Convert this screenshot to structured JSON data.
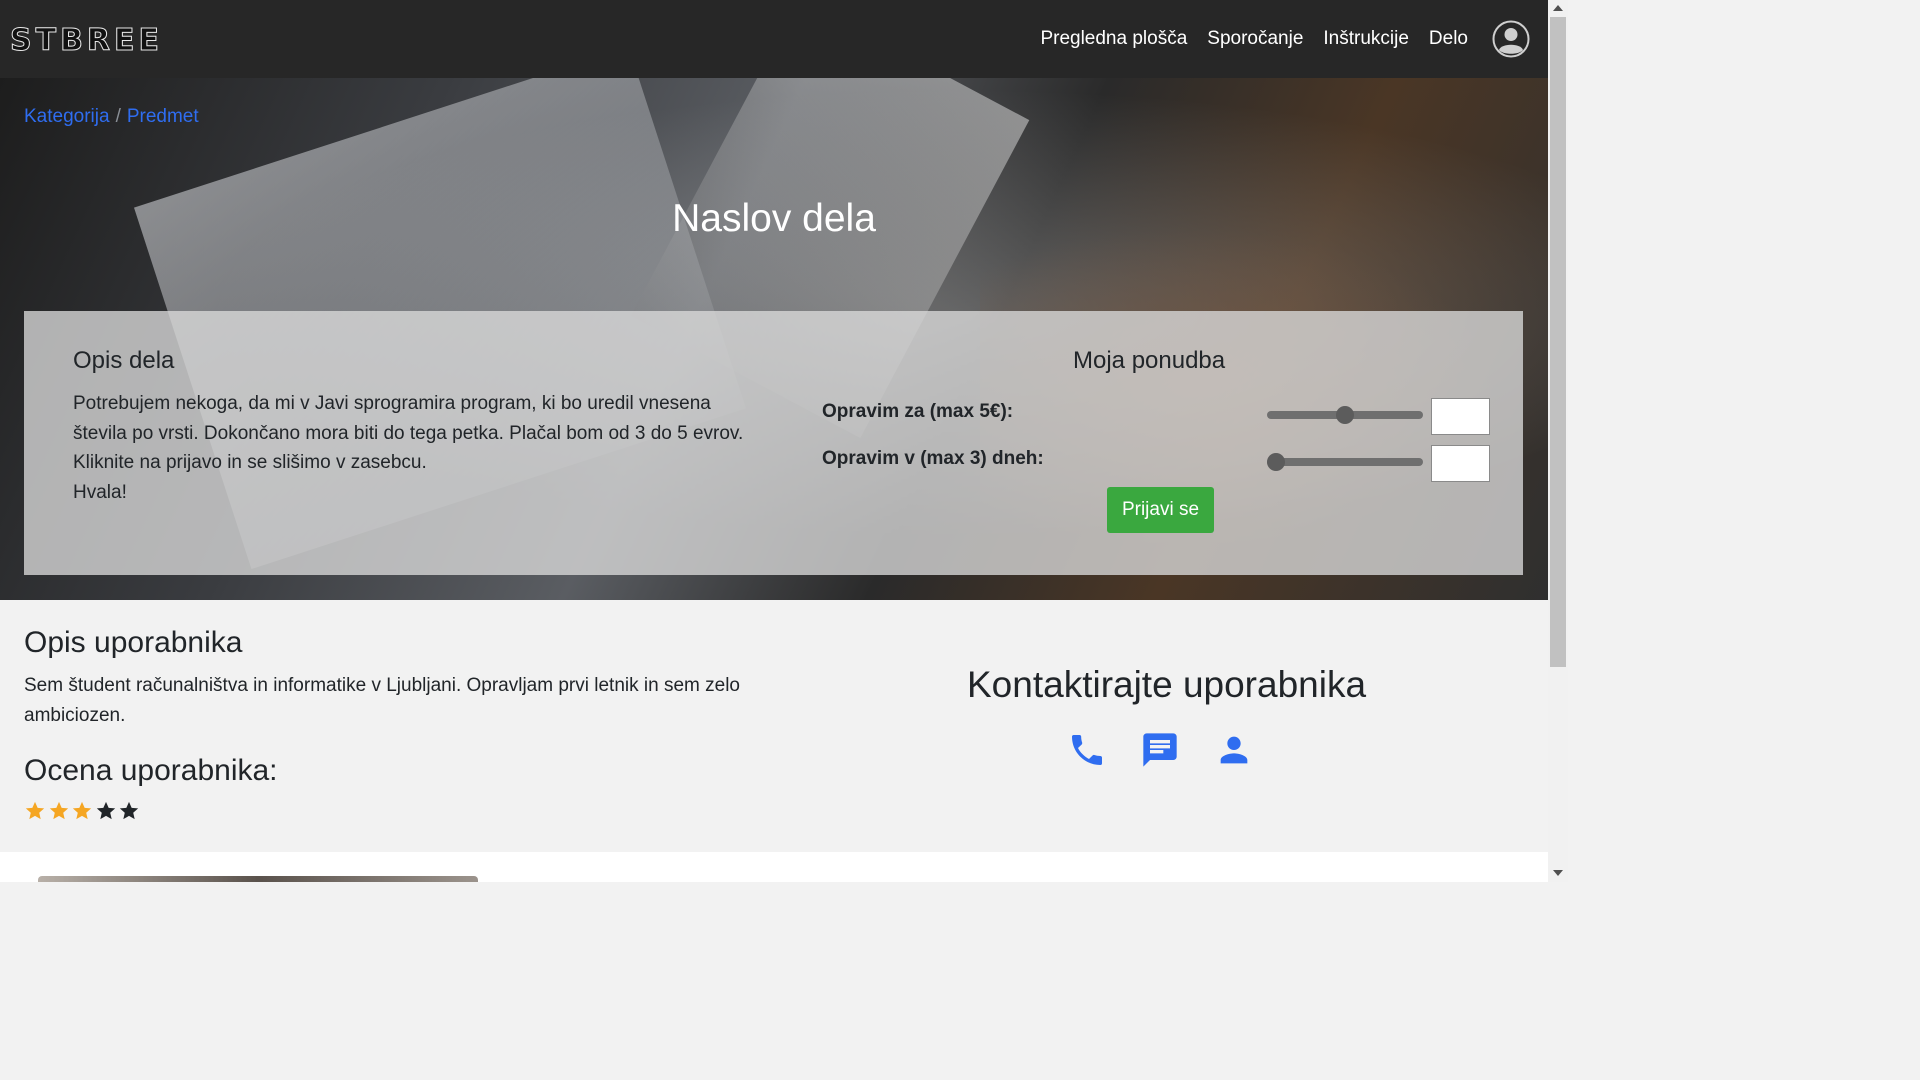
{
  "navbar": {
    "logo_text": "STBREE",
    "links": [
      "Pregledna plošča",
      "Sporočanje",
      "Inštrukcije",
      "Delo"
    ],
    "avatar_icon": "user-circle-icon"
  },
  "breadcrumb": {
    "items": [
      "Kategorija",
      "Predmet"
    ],
    "separator": "/"
  },
  "hero": {
    "title": "Naslov dela"
  },
  "job": {
    "title": "Opis dela",
    "description": "Potrebujem nekoga, da mi v Javi sprogramira program, ki bo uredil vnesena števila po vrsti. Dokončano mora biti do tega petka. Plačal bom od 3 do 5 evrov. Kliknite na prijavo in se slišimo v zasebcu.",
    "closing": "Hvala!"
  },
  "offer": {
    "title": "Moja ponudba",
    "price_label": "Opravim za (max 5€):",
    "price_slider_fraction": 0.5,
    "price_value": "",
    "days_label": "Opravim v (max 3) dneh:",
    "days_slider_fraction": 0.0,
    "days_value": "",
    "submit_label": "Prijavi se",
    "submit_color": "#3aa83f"
  },
  "user": {
    "title": "Opis uporabnika",
    "description": "Sem študent računalništva in informatike v Ljubljani. Opravljam prvi letnik in sem zelo ambiciozen.",
    "rating_title": "Ocena uporabnika:",
    "rating": 3,
    "rating_max": 5,
    "star_filled_color": "#f5a623",
    "star_empty_color": "#212529"
  },
  "contact": {
    "title": "Kontaktirajte uporabnika",
    "icons": [
      "phone-icon",
      "message-icon",
      "person-icon"
    ],
    "icon_color": "#2f6df0"
  }
}
